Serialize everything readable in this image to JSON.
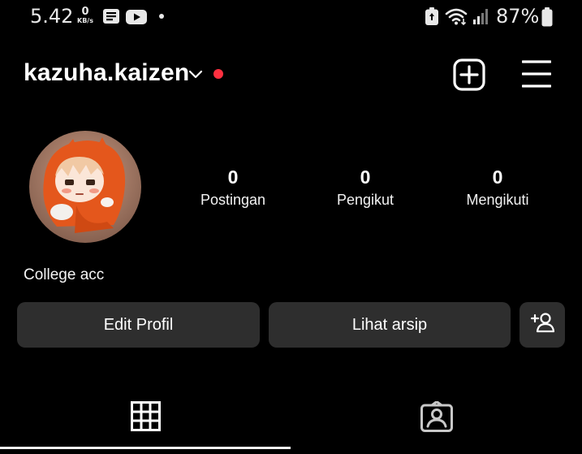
{
  "status_bar": {
    "time": "5.42",
    "net_speed_value": "0",
    "net_speed_unit": "KB/s",
    "battery_percent": "87%",
    "icons": [
      "news-icon",
      "youtube-icon",
      "notification-dot",
      "battery-saver-icon",
      "wifi-icon",
      "signal-icon",
      "battery-icon"
    ]
  },
  "header": {
    "username": "kazuha.kaizen",
    "icons": [
      "chevron-down-icon",
      "notification-dot",
      "create-plus-icon",
      "menu-icon"
    ],
    "notification_color": "#ff3040"
  },
  "profile": {
    "stats": [
      {
        "value": "0",
        "label": "Postingan"
      },
      {
        "value": "0",
        "label": "Pengikut"
      },
      {
        "value": "0",
        "label": "Mengikuti"
      }
    ],
    "bio": "College acc"
  },
  "actions": {
    "edit_profile": "Edit Profil",
    "view_archive": "Lihat arsip",
    "discover_people_icon": "add-person-icon"
  },
  "tabs": {
    "items": [
      "grid-icon",
      "tagged-icon"
    ],
    "active_index": 0
  },
  "colors": {
    "background": "#000000",
    "button_bg": "#2e2e2e",
    "text": "#ffffff"
  }
}
